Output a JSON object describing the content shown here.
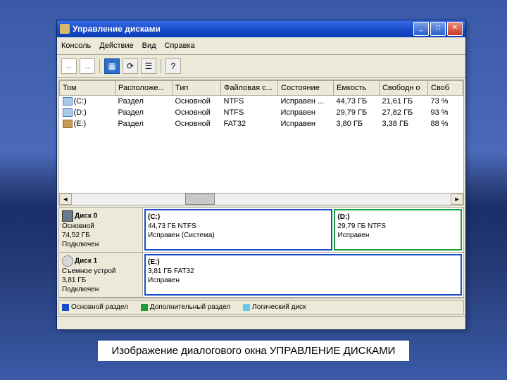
{
  "window": {
    "title": "Управление дисками"
  },
  "menu": {
    "console": "Консоль",
    "action": "Действие",
    "view": "Вид",
    "help": "Справка"
  },
  "columns": {
    "vol": "Том",
    "layout": "Расположе...",
    "type": "Тип",
    "fs": "Файловая с...",
    "status": "Состояние",
    "capacity": "Емкость",
    "free": "Свободн о",
    "pctfree": "Своб"
  },
  "volumes": [
    {
      "name": "(C:)",
      "layout": "Раздел",
      "type": "Основной",
      "fs": "NTFS",
      "status": "Исправен ...",
      "capacity": "44,73 ГБ",
      "free": "21,61 ГБ",
      "pct": "73 %"
    },
    {
      "name": "(D:)",
      "layout": "Раздел",
      "type": "Основной",
      "fs": "NTFS",
      "status": "Исправен",
      "capacity": "29,79 ГБ",
      "free": "27,82 ГБ",
      "pct": "93 %"
    },
    {
      "name": "(E:)",
      "layout": "Раздел",
      "type": "Основной",
      "fs": "FAT32",
      "status": "Исправен",
      "capacity": "3,80 ГБ",
      "free": "3,38 ГБ",
      "pct": "88 %"
    }
  ],
  "disks": [
    {
      "title": "Диск 0",
      "type": "Основной",
      "size": "74,52 ГБ",
      "state": "Подключен",
      "parts": [
        {
          "label": "(С:)",
          "line2": "44,73 ГБ NTFS",
          "line3": "Исправен (Система)",
          "cls": "primary"
        },
        {
          "label": "(D:)",
          "line2": "29,79 ГБ NTFS",
          "line3": "Исправен",
          "cls": "extended"
        }
      ]
    },
    {
      "title": "Диск 1",
      "type": "Съемное устрой",
      "size": "3,81 ГБ",
      "state": "Подключен",
      "parts": [
        {
          "label": "(E:)",
          "line2": "3,81 ГБ FAT32",
          "line3": "Исправен",
          "cls": "primary"
        }
      ]
    }
  ],
  "legend": {
    "primary": "Основной раздел",
    "extended": "Дополнительный раздел",
    "logical": "Логический диск"
  },
  "caption": "Изображение диалогового окна УПРАВЛЕНИЕ ДИСКАМИ"
}
